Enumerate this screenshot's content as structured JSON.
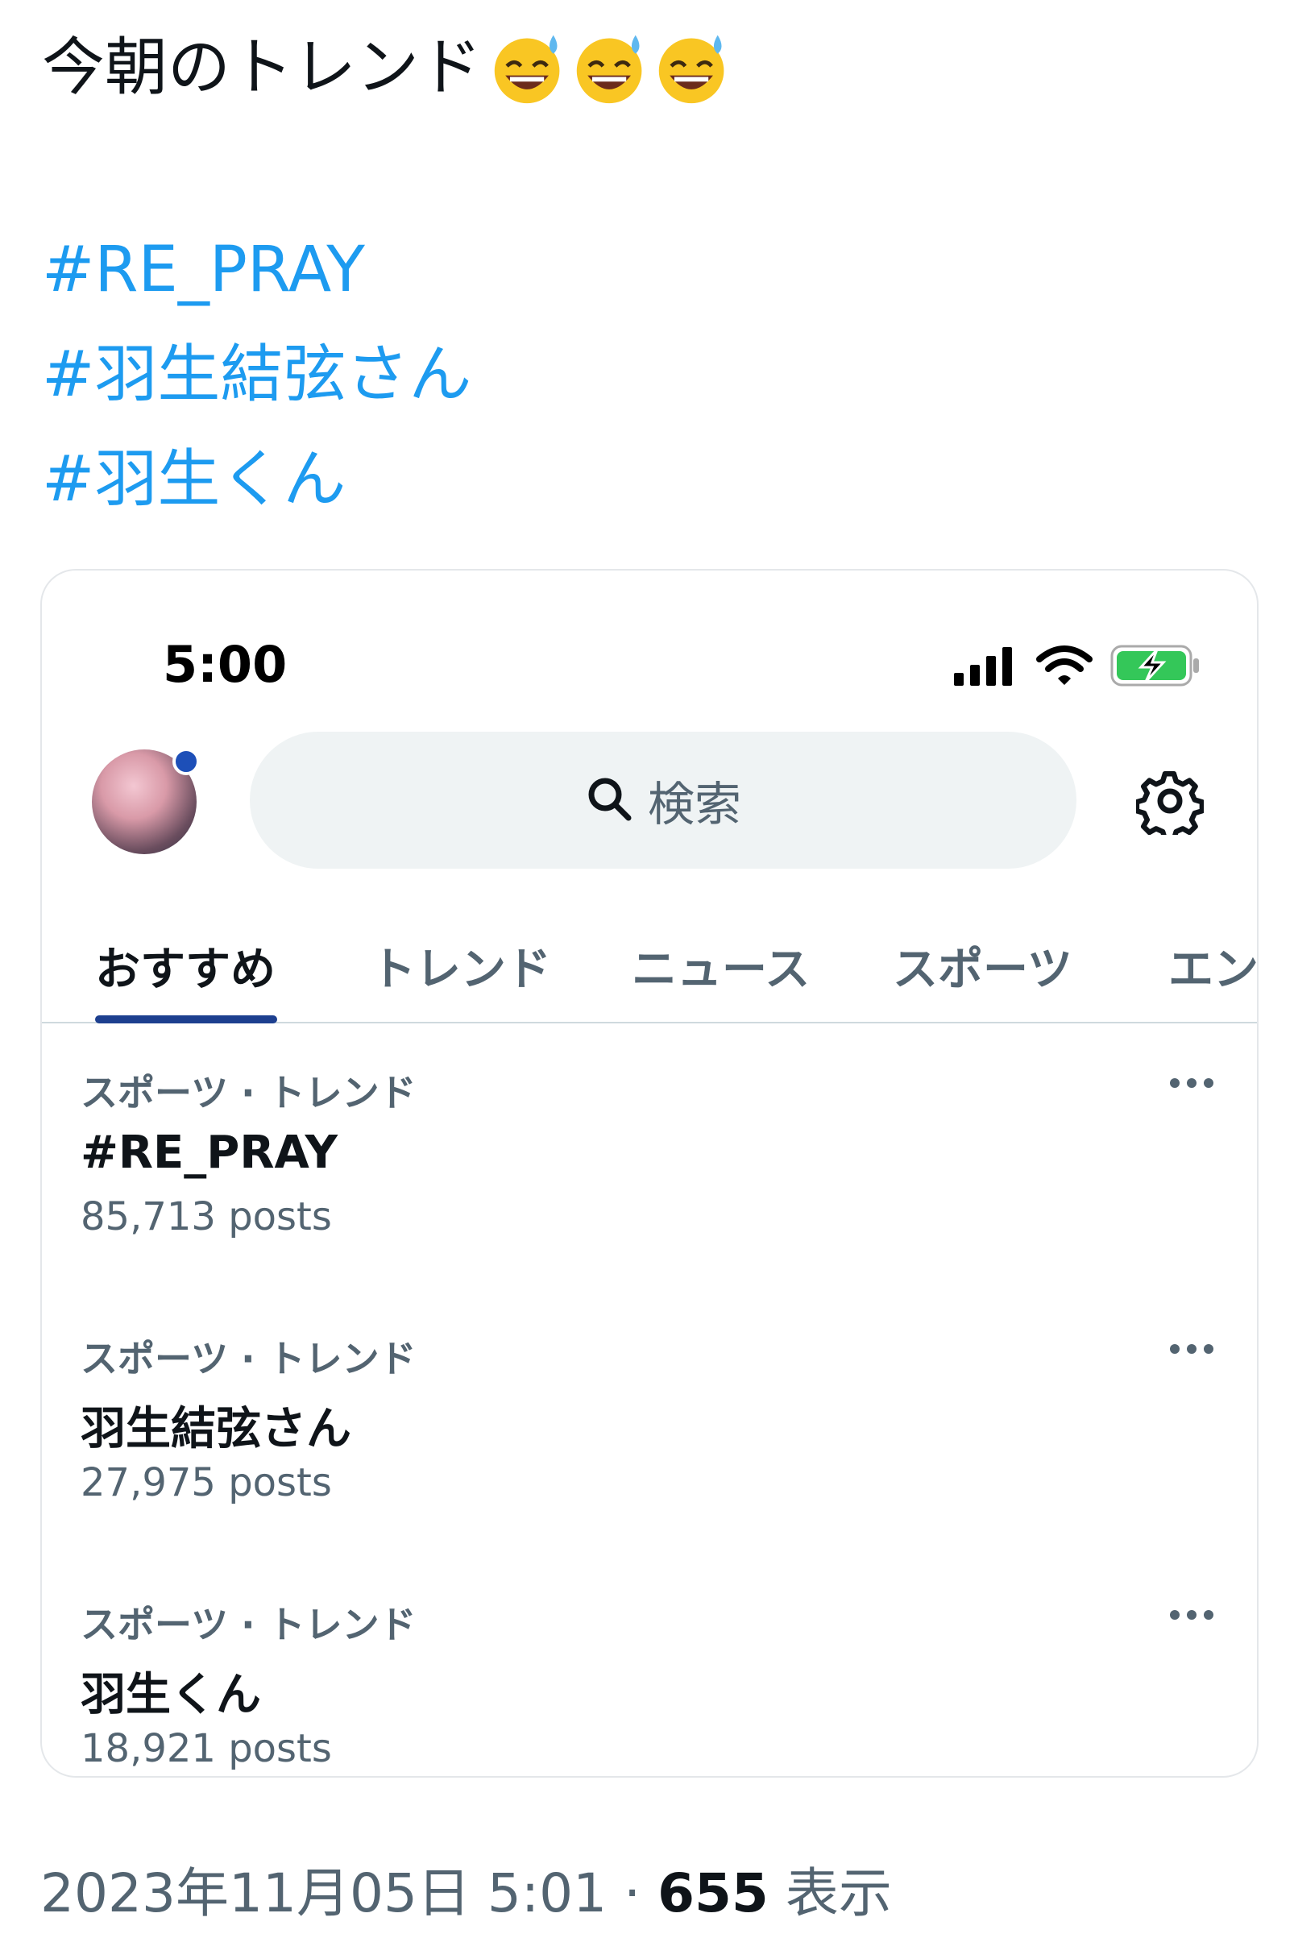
{
  "tweet": {
    "text": "今朝のトレンド",
    "emoji": [
      "grinning-face-with-sweat",
      "grinning-face-with-sweat",
      "grinning-face-with-sweat"
    ],
    "hashtags": [
      "#RE_PRAY",
      "#羽生結弦さん",
      "#羽生くん"
    ]
  },
  "embedded_screenshot": {
    "status_bar": {
      "time": "5:00",
      "icons": [
        "cellular-signal-icon",
        "wifi-icon",
        "battery-charging-icon"
      ],
      "battery_color": "#34c759"
    },
    "header": {
      "search_placeholder": "検索"
    },
    "tabs": [
      {
        "label": "おすすめ",
        "active": true
      },
      {
        "label": "トレンド",
        "active": false
      },
      {
        "label": "ニュース",
        "active": false
      },
      {
        "label": "スポーツ",
        "active": false
      },
      {
        "label": "エン",
        "active": false
      }
    ],
    "trends": [
      {
        "category": "スポーツ · トレンド",
        "title": "#RE_PRAY",
        "count": "85,713 posts"
      },
      {
        "category": "スポーツ · トレンド",
        "title": "羽生結弦さん",
        "count": "27,975 posts"
      },
      {
        "category": "スポーツ · トレンド",
        "title": "羽生くん",
        "count": "18,921 posts"
      }
    ],
    "accent_color": "#1d3f8f"
  },
  "footer": {
    "timestamp": "2023年11月05日 5:01 ·",
    "views_count": "655",
    "views_label": "表示"
  },
  "colors": {
    "hashtag": "#1d9bf0",
    "text": "#0f1419",
    "muted": "#536471"
  }
}
